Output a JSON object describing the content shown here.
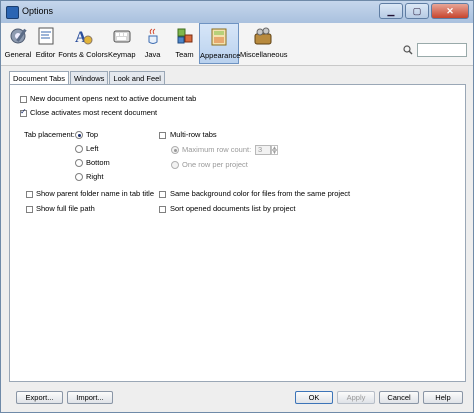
{
  "window": {
    "title": "Options"
  },
  "categories": [
    {
      "label": "General",
      "icon": "general-icon"
    },
    {
      "label": "Editor",
      "icon": "editor-icon"
    },
    {
      "label": "Fonts & Colors",
      "icon": "fonts-colors-icon"
    },
    {
      "label": "Keymap",
      "icon": "keymap-icon"
    },
    {
      "label": "Java",
      "icon": "java-icon"
    },
    {
      "label": "Team",
      "icon": "team-icon"
    },
    {
      "label": "Appearance",
      "icon": "appearance-icon",
      "active": true
    },
    {
      "label": "Miscellaneous",
      "icon": "miscellaneous-icon"
    }
  ],
  "search": {
    "value": ""
  },
  "tabs": [
    {
      "label": "Document Tabs",
      "active": true
    },
    {
      "label": "Windows"
    },
    {
      "label": "Look and Feel"
    }
  ],
  "options": {
    "new_doc_next_to_active": {
      "label": "New document opens next to active document tab",
      "checked": false
    },
    "close_activates_recent": {
      "label": "Close activates most recent document",
      "checked": true
    },
    "tab_placement_label": "Tab placement:",
    "placements": [
      {
        "label": "Top",
        "selected": true
      },
      {
        "label": "Left",
        "selected": false
      },
      {
        "label": "Bottom",
        "selected": false
      },
      {
        "label": "Right",
        "selected": false
      }
    ],
    "multi_row": {
      "label": "Multi-row tabs",
      "checked": false
    },
    "max_row_count": {
      "label": "Maximum row count:",
      "value": "3",
      "selected": true
    },
    "one_row_per_project": {
      "label": "One row per project",
      "selected": false
    },
    "show_parent_folder": {
      "label": "Show parent folder name in tab title",
      "checked": false
    },
    "same_bg_color": {
      "label": "Same background color for files from the same project",
      "checked": false
    },
    "show_full_path": {
      "label": "Show full file path",
      "checked": false
    },
    "sort_by_project": {
      "label": "Sort opened documents list by project",
      "checked": false
    }
  },
  "footer": {
    "export_label": "Export...",
    "import_label": "Import...",
    "ok_label": "OK",
    "apply_label": "Apply",
    "cancel_label": "Cancel",
    "help_label": "Help"
  }
}
